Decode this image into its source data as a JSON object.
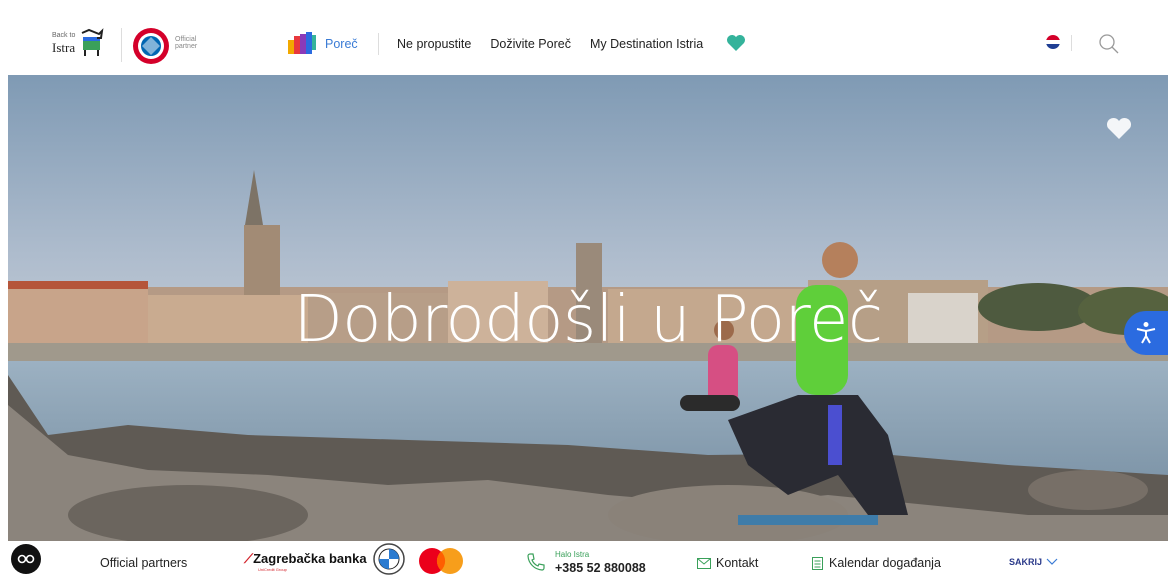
{
  "header": {
    "back_small": "Back to",
    "back_big": "Istra",
    "partner_label_1": "Official",
    "partner_label_2": "partner",
    "porec_link": "Poreč",
    "nav": [
      "Ne propustite",
      "Doživite Poreč",
      "My Destination Istria"
    ],
    "language_icon": "croatian-flag-icon",
    "search_icon": "search-icon"
  },
  "hero": {
    "title": "Dobrodošli u Poreč",
    "favorite_icon": "heart-icon"
  },
  "accessibility_icon": "accessibility-icon",
  "footer": {
    "co_label": "CO",
    "official_partners": "Official partners",
    "zaba": "Zagrebačka banka",
    "zaba_sub": "UniCredit Group",
    "halo_label": "Halo Istra",
    "phone": "+385 52 880088",
    "kontakt": "Kontakt",
    "kalendar": "Kalendar događanja",
    "sakru": "SAKRIJ"
  },
  "colors": {
    "accent": "#3a7bd5",
    "green": "#3aa05a",
    "heart": "#34b39b",
    "a11y": "#2b6be0"
  }
}
